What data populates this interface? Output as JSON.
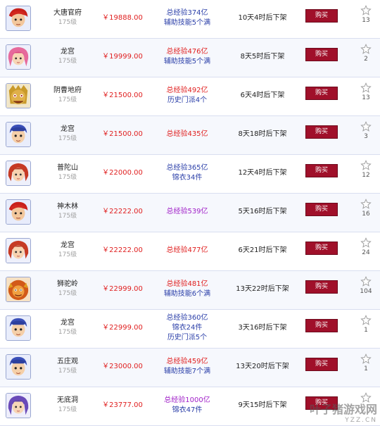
{
  "buy_label": "购买",
  "colors": {
    "price": "#e02020",
    "exp_blue": "#2a3ea8",
    "exp_red": "#e02020",
    "exp_purple": "#a020c8",
    "buy_bg": "#a0102a"
  },
  "rows": [
    {
      "school": "大唐官府",
      "level": "175级",
      "price": "￥19888.00",
      "lines": [
        {
          "text": "总经验374亿",
          "color": "blue"
        },
        {
          "text": "辅助技能5个满",
          "color": "blue"
        }
      ],
      "time": "10天4时后下架",
      "fav": "13",
      "avatar": "red-hair-male"
    },
    {
      "school": "龙宫",
      "level": "175级",
      "price": "￥19999.00",
      "lines": [
        {
          "text": "总经验476亿",
          "color": "red"
        },
        {
          "text": "辅助技能5个满",
          "color": "blue"
        }
      ],
      "time": "8天5时后下架",
      "fav": "2",
      "avatar": "pink-hair-female"
    },
    {
      "school": "阴曹地府",
      "level": "175级",
      "price": "￥21500.00",
      "lines": [
        {
          "text": "总经验492亿",
          "color": "red"
        },
        {
          "text": "历史门派4个",
          "color": "blue"
        }
      ],
      "time": "6天4时后下架",
      "fav": "13",
      "avatar": "beast-face"
    },
    {
      "school": "龙宫",
      "level": "175级",
      "price": "￥21500.00",
      "lines": [
        {
          "text": "总经验435亿",
          "color": "red"
        }
      ],
      "time": "8天18时后下架",
      "fav": "3",
      "avatar": "blue-hair-kid"
    },
    {
      "school": "普陀山",
      "level": "175级",
      "price": "￥22000.00",
      "lines": [
        {
          "text": "总经验365亿",
          "color": "blue"
        },
        {
          "text": "锦衣34件",
          "color": "blue"
        }
      ],
      "time": "12天4时后下架",
      "fav": "12",
      "avatar": "red-hair-girl"
    },
    {
      "school": "神木林",
      "level": "175级",
      "price": "￥22222.00",
      "lines": [
        {
          "text": "总经验539亿",
          "color": "purple"
        }
      ],
      "time": "5天16时后下架",
      "fav": "16",
      "avatar": "red-hair-male"
    },
    {
      "school": "龙宫",
      "level": "175级",
      "price": "￥22222.00",
      "lines": [
        {
          "text": "总经验477亿",
          "color": "red"
        }
      ],
      "time": "6天21时后下架",
      "fav": "24",
      "avatar": "red-hair-girl"
    },
    {
      "school": "狮驼岭",
      "level": "175级",
      "price": "￥22999.00",
      "lines": [
        {
          "text": "总经验481亿",
          "color": "red"
        },
        {
          "text": "辅助技能6个满",
          "color": "blue"
        }
      ],
      "time": "13天22时后下架",
      "fav": "104",
      "avatar": "lion-face"
    },
    {
      "school": "龙宫",
      "level": "175级",
      "price": "￥22999.00",
      "lines": [
        {
          "text": "总经验360亿",
          "color": "blue"
        },
        {
          "text": "锦衣24件",
          "color": "blue"
        },
        {
          "text": "历史门派5个",
          "color": "blue"
        }
      ],
      "time": "3天16时后下架",
      "fav": "1",
      "avatar": "blue-hair-kid"
    },
    {
      "school": "五庄观",
      "level": "175级",
      "price": "￥23000.00",
      "lines": [
        {
          "text": "总经验459亿",
          "color": "red"
        },
        {
          "text": "辅助技能7个满",
          "color": "blue"
        }
      ],
      "time": "13天20时后下架",
      "fav": "1",
      "avatar": "blue-hair-kid"
    },
    {
      "school": "无底洞",
      "level": "175级",
      "price": "￥23777.00",
      "lines": [
        {
          "text": "总经验1000亿",
          "color": "purple"
        },
        {
          "text": "锦衣47件",
          "color": "blue"
        }
      ],
      "time": "9天15时后下架",
      "fav": "",
      "avatar": "purple-hair-female"
    }
  ],
  "watermark": {
    "main": "叶子猪游戏网",
    "sub": "YZZ.CN"
  }
}
